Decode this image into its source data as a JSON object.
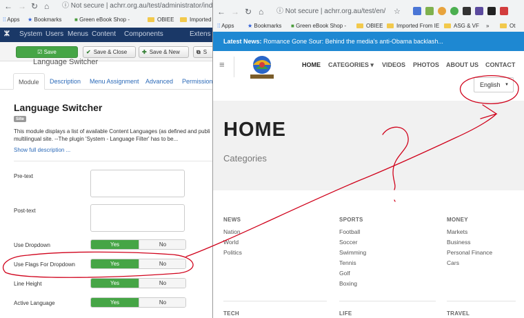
{
  "left": {
    "browser": {
      "url": "achrr.org.au/test/administrator/index",
      "security": "Not secure",
      "bookmarks": [
        "Apps",
        "Bookmarks",
        "Green eBook Shop -",
        "OBIEE",
        "Imported f"
      ]
    },
    "menu": [
      "System",
      "Users",
      "Menus",
      "Content",
      "Components",
      "Extens"
    ],
    "toolbar": {
      "save": "Save",
      "save_close": "Save & Close",
      "save_new": "Save & New",
      "extra": "S"
    },
    "module_input": "Language Switcher",
    "tabs": [
      "Module",
      "Description",
      "Menu Assignment",
      "Advanced",
      "Permissions"
    ],
    "title": "Language Switcher",
    "badge": "Site",
    "description_line1": "This module displays a list of available Content Languages (as defined and publi",
    "description_line2": "multilingual site.  --The plugin 'System - Language Filter' has to be...",
    "show_full": "Show full description ...",
    "fields": {
      "pretext": "Pre-text",
      "posttext": "Post-text",
      "use_dropdown": "Use Dropdown",
      "use_flags": "Use Flags For Dropdown",
      "line_height": "Line Height",
      "active_language": "Active Language"
    },
    "toggle": {
      "yes": "Yes",
      "no": "No"
    }
  },
  "right": {
    "browser": {
      "url": "achrr.org.au/test/en/",
      "security": "Not secure",
      "bookmarks": [
        "Apps",
        "Bookmarks",
        "Green eBook Shop -",
        "OBIEE",
        "Imported From IE",
        "ASG & VF",
        "»",
        "Ot"
      ]
    },
    "news_ticker": {
      "label": "Latest News:",
      "text": "Romance Gone Sour: Behind the media's anti-Obama backlash..."
    },
    "nav": [
      "HOME",
      "CATEGORIES ▾",
      "VIDEOS",
      "PHOTOS",
      "ABOUT US",
      "CONTACT"
    ],
    "language": "English",
    "hero_title": "HOME",
    "hero_sub": "Categories",
    "categories": [
      {
        "head": "NEWS",
        "items": [
          "Nation",
          "World",
          "Politics"
        ]
      },
      {
        "head": "SPORTS",
        "items": [
          "Football",
          "Soccer",
          "Swimming",
          "Tennis",
          "Golf",
          "Boxing"
        ]
      },
      {
        "head": "MONEY",
        "items": [
          "Markets",
          "Business",
          "Personal Finance",
          "Cars"
        ]
      },
      {
        "head": "TECH",
        "items": []
      },
      {
        "head": "LIFE",
        "items": []
      },
      {
        "head": "TRAVEL",
        "items": []
      }
    ]
  },
  "colors": {
    "joomla_nav": "#1a3867",
    "save_green": "#46a546",
    "ticker_blue": "#1e88d2",
    "annotation_red": "#d0021b"
  }
}
